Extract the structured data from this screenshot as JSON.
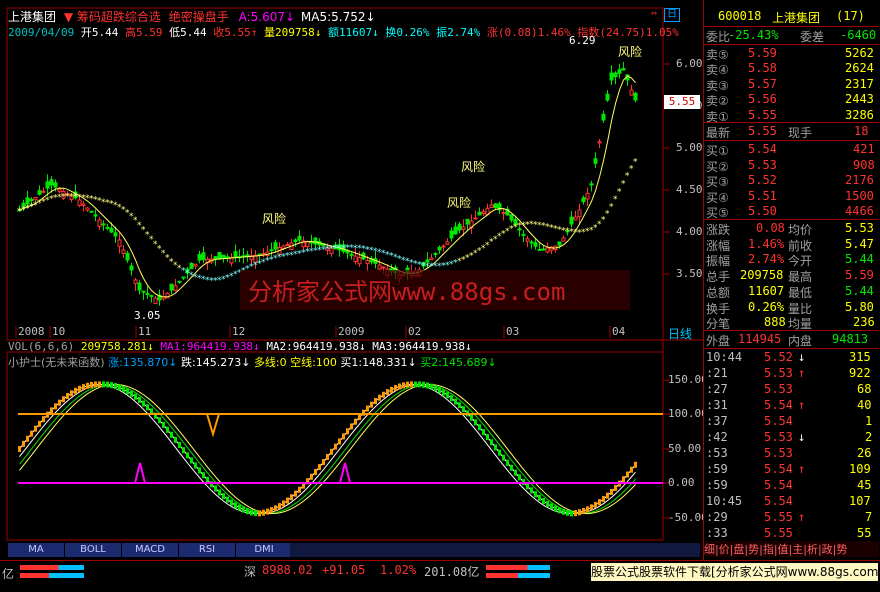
{
  "header": {
    "stock_name": "上港集团",
    "formula_name": "筹码超跌综合选",
    "formula2": "绝密操盘手",
    "ma_a": "A:5.607",
    "ma_5": "MA5:5.752",
    "info_date": "2009/04/09",
    "info_open": "开5.44",
    "info_high": "高5.59",
    "info_low": "低5.44",
    "info_close": "收5.55",
    "info_vol": "量209758",
    "info_amt": "额11607",
    "info_turn": "换0.26%",
    "info_amp": "振2.74%",
    "info_chg": "涨(0.08)1.46%",
    "info_idx": "指数(24.75)1.05%"
  },
  "price_chart": {
    "y_ticks": [
      "6.00",
      "5.50",
      "5.00",
      "4.50",
      "4.00",
      "3.50"
    ],
    "current_price": "5.55",
    "max_label": "6.29",
    "min_label": "3.05",
    "risk_label": "风险",
    "watermark": "分析家公式网www.88gs.com",
    "date_labels": [
      "2008",
      "10",
      "11",
      "12",
      "2009",
      "02",
      "03",
      "04"
    ],
    "day_line_label": "日线"
  },
  "vol_line": {
    "label": "VOL(6,6,6)",
    "vol": "209758.281",
    "ma1": "MA1:964419.938",
    "ma2": "MA2:964419.938",
    "ma3": "MA3:964419.938"
  },
  "indicator": {
    "name": "小护士(无未来函数)",
    "up": "涨:135.870",
    "down": "跌:145.273",
    "bull": "多线:0",
    "bear": "空线:100",
    "buy1": "买1:148.331",
    "buy2": "买2:145.689",
    "y_ticks": [
      "150.00",
      "100.00",
      "50.00",
      "0.00",
      "-50.00"
    ]
  },
  "tabs": [
    "MA",
    "BOLL",
    "MACD",
    "RSI",
    "DMI"
  ],
  "side": {
    "code": "600018",
    "name": "上港集团",
    "num": "(17)",
    "weibi_label": "委比",
    "weibi_val": "-25.43%",
    "weicha_label": "委差",
    "weicha_val": "-6460",
    "sells": [
      {
        "label": "卖⑤",
        "price": "5.59",
        "vol": "5262"
      },
      {
        "label": "卖④",
        "price": "5.58",
        "vol": "2624"
      },
      {
        "label": "卖③",
        "price": "5.57",
        "vol": "2317"
      },
      {
        "label": "卖②",
        "price": "5.56",
        "vol": "2443"
      },
      {
        "label": "卖①",
        "price": "5.55",
        "vol": "3286"
      }
    ],
    "latest_label": "最新",
    "latest_val": "5.55",
    "hand_label": "现手",
    "hand_val": "18",
    "buys": [
      {
        "label": "买①",
        "price": "5.54",
        "vol": "421"
      },
      {
        "label": "买②",
        "price": "5.53",
        "vol": "908"
      },
      {
        "label": "买③",
        "price": "5.52",
        "vol": "2176"
      },
      {
        "label": "买④",
        "price": "5.51",
        "vol": "1500"
      },
      {
        "label": "买⑤",
        "price": "5.50",
        "vol": "4466"
      }
    ],
    "stats": [
      {
        "l1": "涨跌",
        "v1": "0.08",
        "l2": "均价",
        "v2": "5.53"
      },
      {
        "l1": "涨幅",
        "v1": "1.46%",
        "l2": "前收",
        "v2": "5.47"
      },
      {
        "l1": "振幅",
        "v1": "2.74%",
        "l2": "今开",
        "v2": "5.44"
      },
      {
        "l1": "总手",
        "v1": "209758",
        "l2": "最高",
        "v2": "5.59"
      },
      {
        "l1": "总额",
        "v1": "11607",
        "l2": "最低",
        "v2": "5.44"
      },
      {
        "l1": "换手",
        "v1": "0.26%",
        "l2": "量比",
        "v2": "5.80"
      },
      {
        "l1": "分笔",
        "v1": "888",
        "l2": "均量",
        "v2": "236"
      }
    ],
    "outer_label": "外盘",
    "outer_val": "114945",
    "inner_label": "内盘",
    "inner_val": "94813",
    "ticks": [
      {
        "t": "10:44",
        "p": "5.52",
        "a": "↓",
        "v": "315"
      },
      {
        "t": ":21",
        "p": "5.53",
        "a": "↑",
        "v": "922"
      },
      {
        "t": ":27",
        "p": "5.53",
        "a": "",
        "v": "68"
      },
      {
        "t": ":31",
        "p": "5.54",
        "a": "↑",
        "v": "40"
      },
      {
        "t": ":37",
        "p": "5.54",
        "a": "",
        "v": "1"
      },
      {
        "t": ":42",
        "p": "5.53",
        "a": "↓",
        "v": "2"
      },
      {
        "t": ":53",
        "p": "5.53",
        "a": "",
        "v": "26"
      },
      {
        "t": ":59",
        "p": "5.54",
        "a": "↑",
        "v": "109"
      },
      {
        "t": ":59",
        "p": "5.54",
        "a": "",
        "v": "45"
      },
      {
        "t": "10:45",
        "p": "5.54",
        "a": "",
        "v": "107"
      },
      {
        "t": ":29",
        "p": "5.55",
        "a": "↑",
        "v": "7"
      },
      {
        "t": ":33",
        "p": "5.55",
        "a": "",
        "v": "55"
      }
    ],
    "bottom_tabs": "细|价|盘|势|指|值|主|析|政|势"
  },
  "status": {
    "left": "亿",
    "market": "深",
    "idx": "8988.02",
    "chg": "+91.05",
    "pct": "1.02%",
    "amt": "201.08亿",
    "ad": "股票公式股票软件下载[分析家公式网www.88gs.com]"
  }
}
